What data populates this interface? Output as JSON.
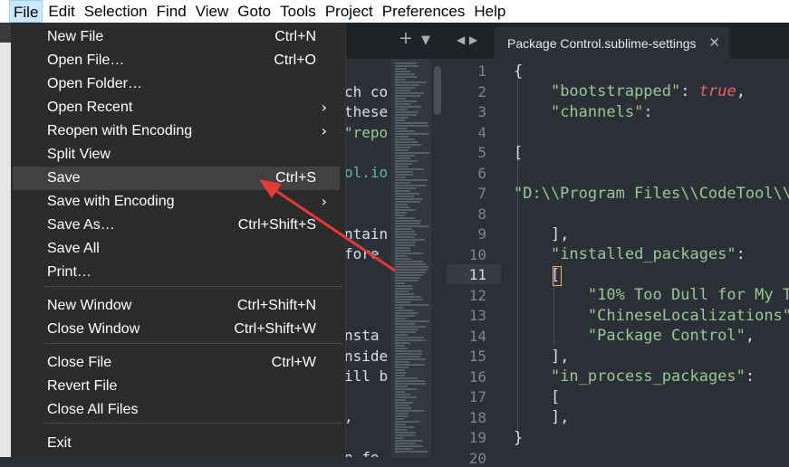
{
  "menubar": {
    "items": [
      "File",
      "Edit",
      "Selection",
      "Find",
      "View",
      "Goto",
      "Tools",
      "Project",
      "Preferences",
      "Help"
    ]
  },
  "tab": {
    "title": "Package Control.sublime-settings",
    "close": "✕",
    "add_icon": "+",
    "dropdown_icon": "▼",
    "prev_icon": "◀",
    "next_icon": "▶"
  },
  "left_pane": {
    "lines": [
      "ch co",
      "these",
      "\"repo",
      "",
      "ol.io",
      "",
      "",
      "ntain",
      "fore",
      "",
      "",
      "",
      "nsta",
      "nside",
      "ill b",
      "",
      ",",
      "",
      "n fo"
    ]
  },
  "file_menu": {
    "items": [
      {
        "label": "New File",
        "shortcut": "Ctrl+N"
      },
      {
        "label": "Open File…",
        "shortcut": "Ctrl+O"
      },
      {
        "label": "Open Folder…",
        "shortcut": ""
      },
      {
        "label": "Open Recent",
        "shortcut": "",
        "submenu": true
      },
      {
        "label": "Reopen with Encoding",
        "shortcut": "",
        "submenu": true
      },
      {
        "label": "Split View",
        "shortcut": ""
      },
      {
        "label": "Save",
        "shortcut": "Ctrl+S",
        "hover": true
      },
      {
        "label": "Save with Encoding",
        "shortcut": "",
        "submenu": true
      },
      {
        "label": "Save As…",
        "shortcut": "Ctrl+Shift+S"
      },
      {
        "label": "Save All",
        "shortcut": ""
      },
      {
        "label": "Print…",
        "shortcut": ""
      },
      {
        "label": "New Window",
        "shortcut": "Ctrl+Shift+N"
      },
      {
        "label": "Close Window",
        "shortcut": "Ctrl+Shift+W"
      },
      {
        "label": "Close File",
        "shortcut": "Ctrl+W"
      },
      {
        "label": "Revert File",
        "shortcut": ""
      },
      {
        "label": "Close All Files",
        "shortcut": ""
      },
      {
        "label": "Exit",
        "shortcut": ""
      }
    ],
    "submenu_arrow": "›"
  },
  "gutter": {
    "numbers": [
      "1",
      "2",
      "3",
      "4",
      "5",
      "6",
      "7",
      "8",
      "9",
      "10",
      "11",
      "12",
      "13",
      "14",
      "15",
      "16",
      "17",
      "18",
      "19",
      "20"
    ],
    "active": "11"
  },
  "code": {
    "l1": "{",
    "l2_key": "\"bootstrapped\"",
    "l2_sep": ": ",
    "l2_val": "true",
    "l2_end": ",",
    "l3_key": "\"channels\"",
    "l3_end": ":",
    "l5": "[",
    "l7": "\"D:\\\\Program Files\\\\CodeTool\\\\",
    "l9": "],",
    "l10_key": "\"installed_packages\"",
    "l10_end": ":",
    "l11": "[",
    "l12": "\"10% Too Dull for My T",
    "l13": "\"ChineseLocalizations\"",
    "l14": "\"Package Control\"",
    "l14_end": ",",
    "l15": "],",
    "l16_key": "\"in_process_packages\"",
    "l16_end": ":",
    "l17": "[",
    "l18": "],",
    "l19": "}"
  },
  "colors": {
    "accent_arrow": "#e53935",
    "string": "#99c794",
    "keyword": "#ec5f67",
    "cursor": "#f9ae58"
  }
}
